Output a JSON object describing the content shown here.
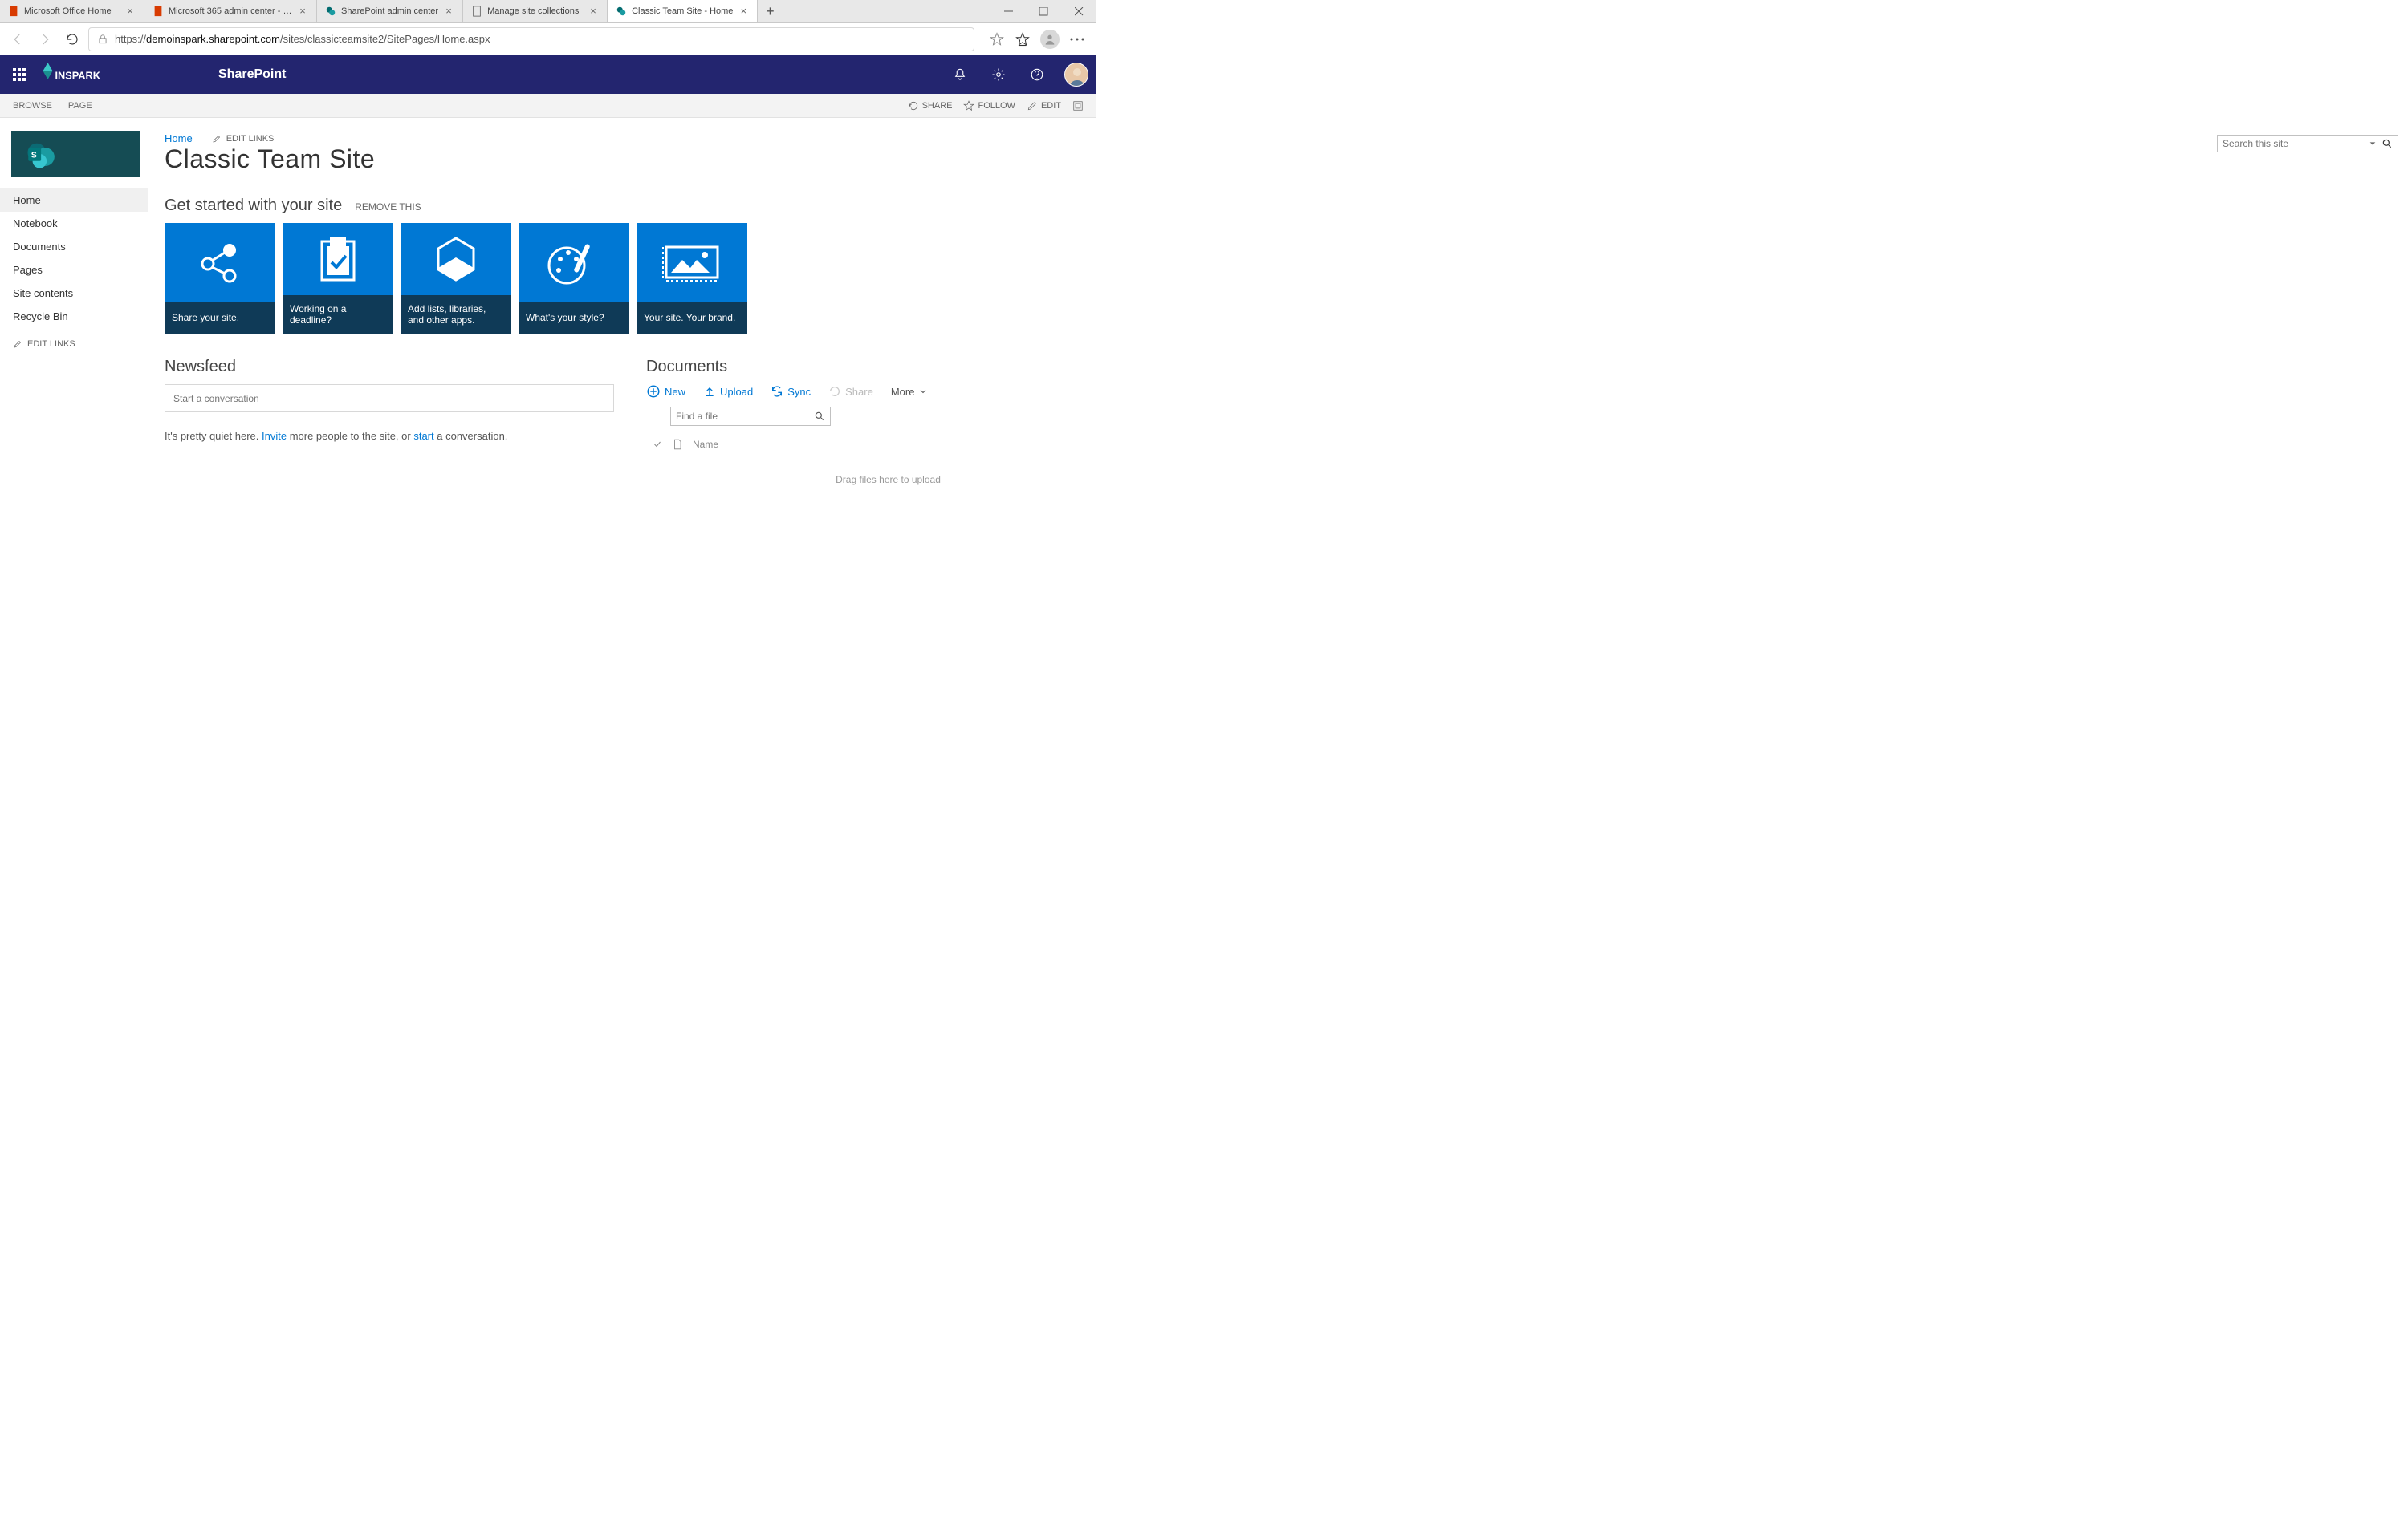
{
  "browser": {
    "tabs": [
      {
        "title": "Microsoft Office Home",
        "favicon": "office"
      },
      {
        "title": "Microsoft 365 admin center - M…",
        "favicon": "office"
      },
      {
        "title": "SharePoint admin center",
        "favicon": "sharepoint"
      },
      {
        "title": "Manage site collections",
        "favicon": "page"
      },
      {
        "title": "Classic Team Site - Home",
        "favicon": "sharepoint",
        "active": true
      }
    ],
    "url_prefix": "https://",
    "url_host": "demoinspark.sharepoint.com",
    "url_path": "/sites/classicteamsite2/SitePages/Home.aspx"
  },
  "suite": {
    "tenant": "INSPARK",
    "app": "SharePoint"
  },
  "ribbon": {
    "tabs": [
      "BROWSE",
      "PAGE"
    ],
    "actions": {
      "share": "SHARE",
      "follow": "FOLLOW",
      "edit": "EDIT"
    }
  },
  "leftnav": {
    "items": [
      "Home",
      "Notebook",
      "Documents",
      "Pages",
      "Site contents",
      "Recycle Bin"
    ],
    "edit_links": "EDIT LINKS"
  },
  "page": {
    "breadcrumb": "Home",
    "edit_links": "EDIT LINKS",
    "title": "Classic Team Site",
    "search_placeholder": "Search this site"
  },
  "getstarted": {
    "title": "Get started with your site",
    "remove": "REMOVE THIS",
    "tiles": [
      "Share your site.",
      "Working on a deadline?",
      "Add lists, libraries, and other apps.",
      "What's your style?",
      "Your site. Your brand."
    ]
  },
  "newsfeed": {
    "title": "Newsfeed",
    "placeholder": "Start a conversation",
    "quiet_pre": "It's pretty quiet here. ",
    "invite": "Invite",
    "quiet_mid": " more people to the site, or ",
    "start": "start",
    "quiet_post": " a conversation."
  },
  "documents": {
    "title": "Documents",
    "toolbar": {
      "new": "New",
      "upload": "Upload",
      "sync": "Sync",
      "share": "Share",
      "more": "More"
    },
    "find_placeholder": "Find a file",
    "col_name": "Name",
    "drag_hint": "Drag files here to upload"
  }
}
